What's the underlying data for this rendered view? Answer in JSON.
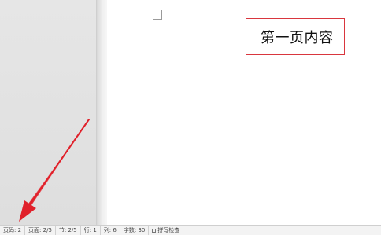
{
  "document": {
    "text_box": {
      "text": "第一页内容"
    }
  },
  "status_bar": {
    "items": [
      {
        "label": "页码: 2"
      },
      {
        "label": "页面: 2/5"
      },
      {
        "label": "节: 2/5"
      },
      {
        "label": "行: 1"
      },
      {
        "label": "列: 6"
      },
      {
        "label": "字数: 30"
      },
      {
        "label": "拼写检查"
      }
    ]
  },
  "annotation": {
    "arrow_color": "#e0202a",
    "points_to": "页码: 2"
  },
  "colors": {
    "text_box_border": "#d9363e",
    "statusbar_bg": "#f3f3f3",
    "gray_area": "#e3e3e3"
  }
}
